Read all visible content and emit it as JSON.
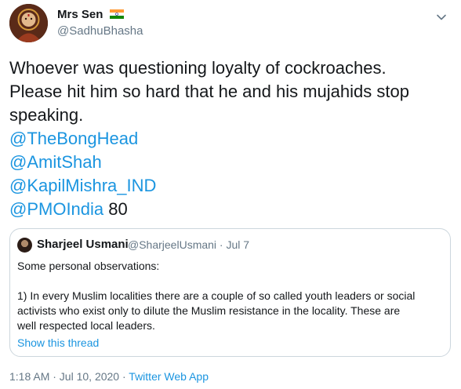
{
  "author": {
    "name": "Mrs Sen",
    "handle": "@SadhuBhasha",
    "flag_icon": "india-flag-icon"
  },
  "tweet": {
    "text_lines": [
      "Whoever was questioning loyalty of cockroaches.",
      "Please hit him so hard that he and his mujahids stop",
      "speaking."
    ],
    "mentions": [
      "@TheBongHead",
      "@AmitShah",
      "@KapilMishra_IND",
      "@PMOIndia"
    ],
    "trailing_text": " 80"
  },
  "quoted_tweet": {
    "name": "Sharjeel Usmani",
    "handle_and_date": "@SharjeelUsmani · Jul 7",
    "lines": [
      "Some personal observations:",
      "1) In every Muslim localities there are a couple of so called youth leaders or social",
      "activists who exist only to dilute the Muslim resistance in the locality. These are",
      "well respected local leaders."
    ],
    "show_thread_label": "Show this thread"
  },
  "meta": {
    "timestamp": "1:18 AM · Jul 10, 2020",
    "separator": " · ",
    "source": "Twitter Web App"
  },
  "colors": {
    "link": "#1b95e0",
    "secondary_text": "#657786",
    "border": "#ccd6dd"
  }
}
